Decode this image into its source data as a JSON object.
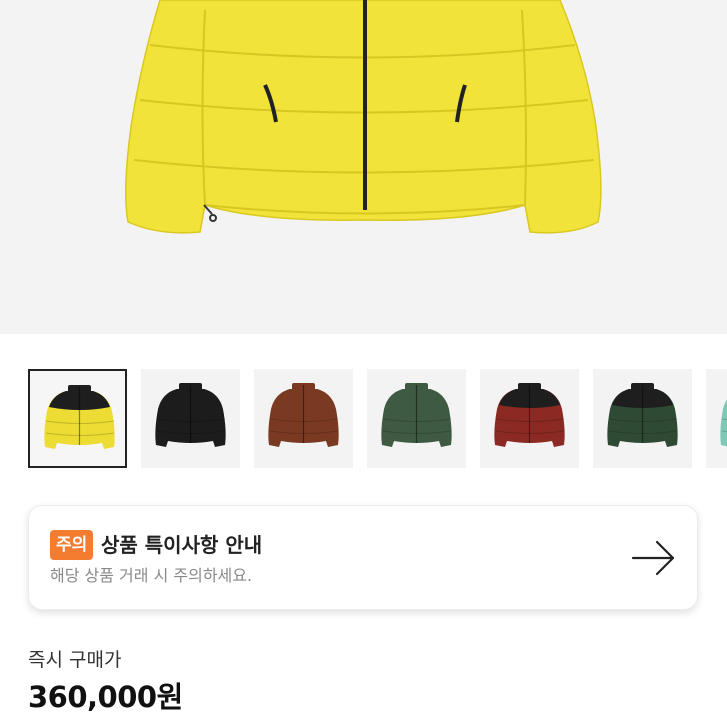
{
  "product": {
    "hero_colors": {
      "jacket": "#f2e33a",
      "zipper": "#222222",
      "background": "#f3f3f3"
    },
    "thumbnails": [
      {
        "name": "yellow-black",
        "selected": true,
        "body": "#ecdc33",
        "yoke": "#1e1e1e"
      },
      {
        "name": "black",
        "selected": false,
        "body": "#1c1c1c",
        "yoke": "#1c1c1c"
      },
      {
        "name": "brown",
        "selected": false,
        "body": "#7a3a22",
        "yoke": "#7a3a22"
      },
      {
        "name": "olive-green",
        "selected": false,
        "body": "#3e5a42",
        "yoke": "#3e5a42"
      },
      {
        "name": "red-black",
        "selected": false,
        "body": "#8a2a22",
        "yoke": "#1e1e1e"
      },
      {
        "name": "dark-green-black",
        "selected": false,
        "body": "#2e4a34",
        "yoke": "#1e1e1e"
      },
      {
        "name": "mint",
        "selected": false,
        "body": "#7ec8b6",
        "yoke": "#7ec8b6"
      }
    ]
  },
  "notice": {
    "badge": "주의",
    "title": "상품 특이사항 안내",
    "description": "해당 상품 거래 시 주의하세요.",
    "arrow_icon": "arrow-right-icon",
    "badge_color": "#f47c30"
  },
  "price": {
    "label": "즉시 구매가",
    "value": "360,000원"
  }
}
